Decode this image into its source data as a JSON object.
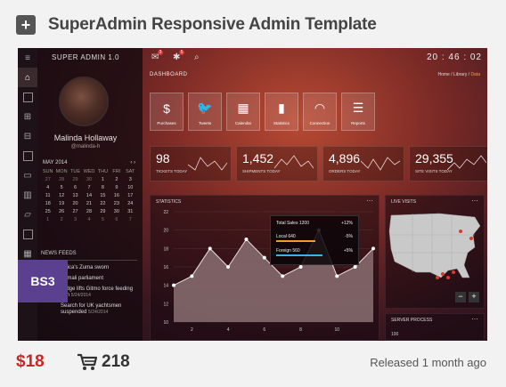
{
  "product": {
    "title": "SuperAdmin Responsive Admin Template",
    "price": "$18",
    "sales": "218",
    "released": "Released 1 month ago",
    "badge": "BS3"
  },
  "preview": {
    "brand": "SUPER ADMIN 1.0",
    "clock": "20 : 46 : 02",
    "page": "DASHBOARD",
    "breadcrumb": {
      "home": "Home",
      "sep1": "/",
      "library": "Library",
      "sep2": "/",
      "data": "Data"
    },
    "notif_badges": [
      "3",
      "5"
    ],
    "profile": {
      "name": "Malinda Hollaway",
      "handle": "@malinda-h"
    },
    "calendar": {
      "month": "MAY 2014",
      "prev": "‹",
      "next": "›",
      "dow": [
        "SUN",
        "MON",
        "TUE",
        "WED",
        "THU",
        "FRI",
        "SAT"
      ],
      "rows": [
        [
          "27",
          "28",
          "29",
          "30",
          "1",
          "2",
          "3"
        ],
        [
          "4",
          "5",
          "6",
          "7",
          "8",
          "9",
          "10"
        ],
        [
          "11",
          "12",
          "13",
          "14",
          "15",
          "16",
          "17"
        ],
        [
          "18",
          "19",
          "20",
          "21",
          "22",
          "23",
          "24"
        ],
        [
          "25",
          "26",
          "27",
          "28",
          "29",
          "30",
          "31"
        ],
        [
          "1",
          "2",
          "3",
          "4",
          "5",
          "6",
          "7"
        ]
      ]
    },
    "news": {
      "heading": "NEWS FEEDS",
      "items": [
        {
          "text": "Africa's Zuma sworn",
          "date": ""
        },
        {
          "text": "Somali parliament",
          "date": ""
        },
        {
          "text": "Judge lifts Gitmo force feeding ban",
          "date": "5/24/2014"
        },
        {
          "text": "Search for UK yachtsmen suspended",
          "date": "5/24/2014"
        }
      ]
    },
    "tiles": [
      {
        "label": "Purchases",
        "icon": "dollar-icon",
        "glyph": "$"
      },
      {
        "label": "Tweets",
        "icon": "twitter-icon",
        "glyph": "🐦"
      },
      {
        "label": "Calendar",
        "icon": "calendar-icon",
        "glyph": "▦"
      },
      {
        "label": "Statistics",
        "icon": "bar-chart-icon",
        "glyph": "▮"
      },
      {
        "label": "Connection",
        "icon": "wifi-icon",
        "glyph": "◠"
      },
      {
        "label": "Reports",
        "icon": "list-icon",
        "glyph": "☰"
      }
    ],
    "stats": [
      {
        "value": "98",
        "label": "TICKETS TODAY"
      },
      {
        "value": "1,452",
        "label": "SHIPMENTS TODAY"
      },
      {
        "value": "4,896",
        "label": "ORDERS TODAY"
      },
      {
        "value": "29,355",
        "label": "SITE VISITS TODAY"
      }
    ],
    "statistics": {
      "heading": "STATISTICS",
      "dots": "···",
      "tooltip": {
        "total": "Total Sales 1200",
        "total_change": "+12%",
        "local": "Local 640",
        "local_change": "-5%",
        "foreign": "Foreign 560",
        "foreign_change": "+5%"
      }
    },
    "live_visits": {
      "heading": "LIVE VISITS",
      "dots": "···",
      "zoom_out": "−",
      "zoom_in": "+"
    },
    "server_process": {
      "heading": "SERVER PROCESS",
      "dots": "···",
      "axis_top": "100"
    }
  },
  "chart_data": {
    "type": "area",
    "title": "",
    "x": [
      1,
      2,
      3,
      4,
      5,
      6,
      7,
      8,
      9,
      10,
      11,
      12
    ],
    "xticks": [
      2,
      4,
      6,
      8,
      10
    ],
    "values": [
      14,
      15,
      18,
      16,
      19,
      17,
      15,
      16,
      20,
      15,
      16,
      18
    ],
    "yticks": [
      10,
      12,
      14,
      16,
      18,
      20,
      22
    ],
    "ylim": [
      10,
      22
    ],
    "grid": true,
    "colors": {
      "fill": "#8a6f72",
      "line": "#e9dede",
      "point": "#ffffff"
    }
  }
}
